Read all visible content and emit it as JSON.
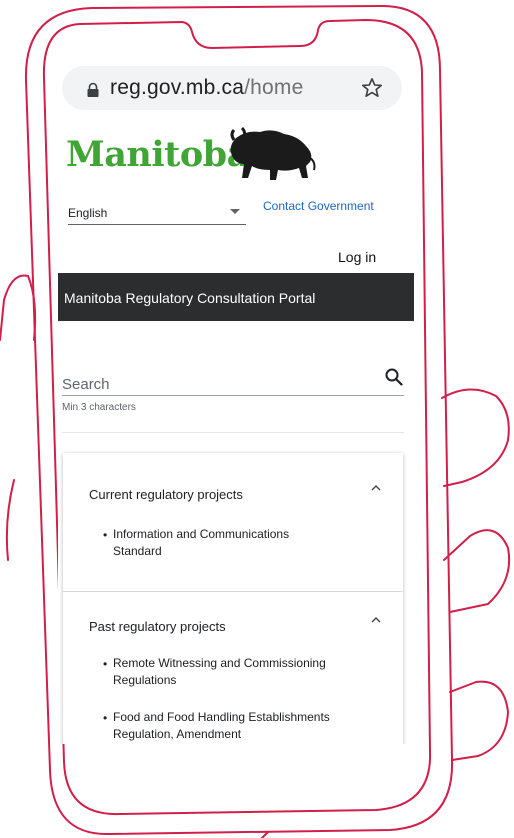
{
  "browser": {
    "url_domain": "reg.gov.mb.ca",
    "url_path": "/home"
  },
  "header": {
    "logo_text": "Manitoba",
    "language_selected": "English",
    "contact_link": "Contact Government",
    "login_link": "Log in"
  },
  "banner": {
    "title": "Manitoba Regulatory Consultation Portal"
  },
  "search": {
    "placeholder": "Search",
    "hint": "Min 3 characters"
  },
  "sections": [
    {
      "title": "Current regulatory projects",
      "items": [
        {
          "line1": "Information and Communications",
          "line2": "Standard"
        }
      ]
    },
    {
      "title": "Past regulatory projects",
      "items": [
        {
          "line1": "Remote Witnessing and Commissioning",
          "line2": "Regulations"
        },
        {
          "line1": "Food and Food Handling Establishments",
          "line2": "Regulation, Amendment"
        }
      ]
    }
  ],
  "colors": {
    "brand_green": "#3fa535",
    "link_blue": "#1a66c2",
    "banner_bg": "#2c2d2f",
    "outline_red": "#d11f4a"
  }
}
